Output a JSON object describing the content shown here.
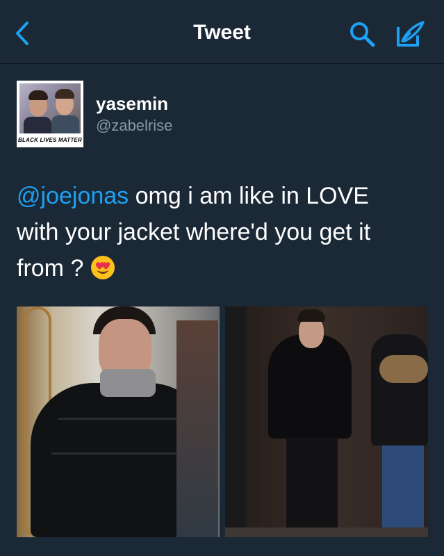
{
  "nav": {
    "title": "Tweet",
    "back_icon": "chevron-left-icon",
    "search_icon": "search-icon",
    "compose_icon": "compose-icon"
  },
  "tweet": {
    "avatar_banner": "BLACK LIVES MATTER",
    "display_name": "yasemin",
    "handle": "@zabelrise",
    "mention": "@joejonas",
    "text_line1": " omg i am like in LOVE",
    "text_line2": "with your jacket where'd you get it",
    "text_line3": "from ?",
    "emoji": "smiling-face-with-heart-eyes"
  },
  "media": [
    {
      "icon": "photo-man-black-puffer-jacket-closeup"
    },
    {
      "icon": "photo-man-black-puffer-jacket-full"
    }
  ],
  "colors": {
    "background": "#1b2836",
    "accent": "#1da1f2",
    "text": "#ffffff",
    "secondary_text": "#8899a6"
  }
}
